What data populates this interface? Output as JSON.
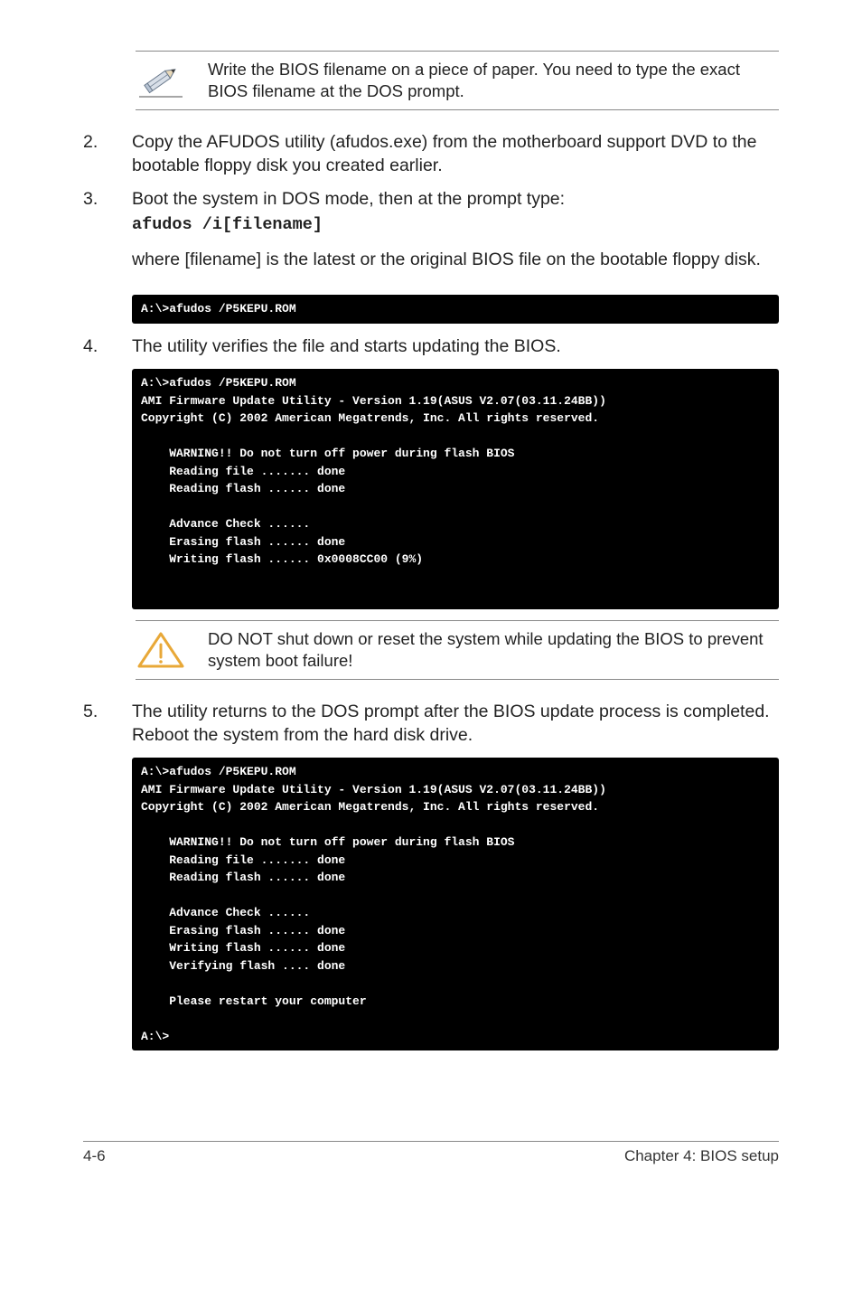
{
  "note1": "Write the BIOS filename on a piece of paper. You need to type the exact BIOS filename at the DOS prompt.",
  "item2_num": "2.",
  "item2_text": "Copy the AFUDOS utility (afudos.exe) from the motherboard support DVD to the bootable floppy disk you created earlier.",
  "item3_num": "3.",
  "item3_text": "Boot the system in DOS mode, then at the prompt type:",
  "item3_code": "afudos /i[filename]",
  "item3_para": "where [filename] is the latest or the original BIOS file on the bootable floppy disk.",
  "term1": "A:\\>afudos /P5KEPU.ROM",
  "item4_num": "4.",
  "item4_text": "The utility verifies the file and starts updating the BIOS.",
  "term2": "A:\\>afudos /P5KEPU.ROM\nAMI Firmware Update Utility - Version 1.19(ASUS V2.07(03.11.24BB))\nCopyright (C) 2002 American Megatrends, Inc. All rights reserved.\n\n    WARNING!! Do not turn off power during flash BIOS\n    Reading file ....... done\n    Reading flash ...... done\n\n    Advance Check ......\n    Erasing flash ...... done\n    Writing flash ...... 0x0008CC00 (9%)\n\n\n",
  "note2": "DO NOT shut down or reset the system while updating the BIOS to prevent system boot failure!",
  "item5_num": "5.",
  "item5_text": "The utility returns to the DOS prompt after the BIOS update process is completed. Reboot the system from the hard disk drive.",
  "term3": "A:\\>afudos /P5KEPU.ROM\nAMI Firmware Update Utility - Version 1.19(ASUS V2.07(03.11.24BB))\nCopyright (C) 2002 American Megatrends, Inc. All rights reserved.\n\n    WARNING!! Do not turn off power during flash BIOS\n    Reading file ....... done\n    Reading flash ...... done\n\n    Advance Check ......\n    Erasing flash ...... done\n    Writing flash ...... done\n    Verifying flash .... done\n\n    Please restart your computer\n\nA:\\>",
  "footer_left": "4-6",
  "footer_right": "Chapter 4: BIOS setup"
}
